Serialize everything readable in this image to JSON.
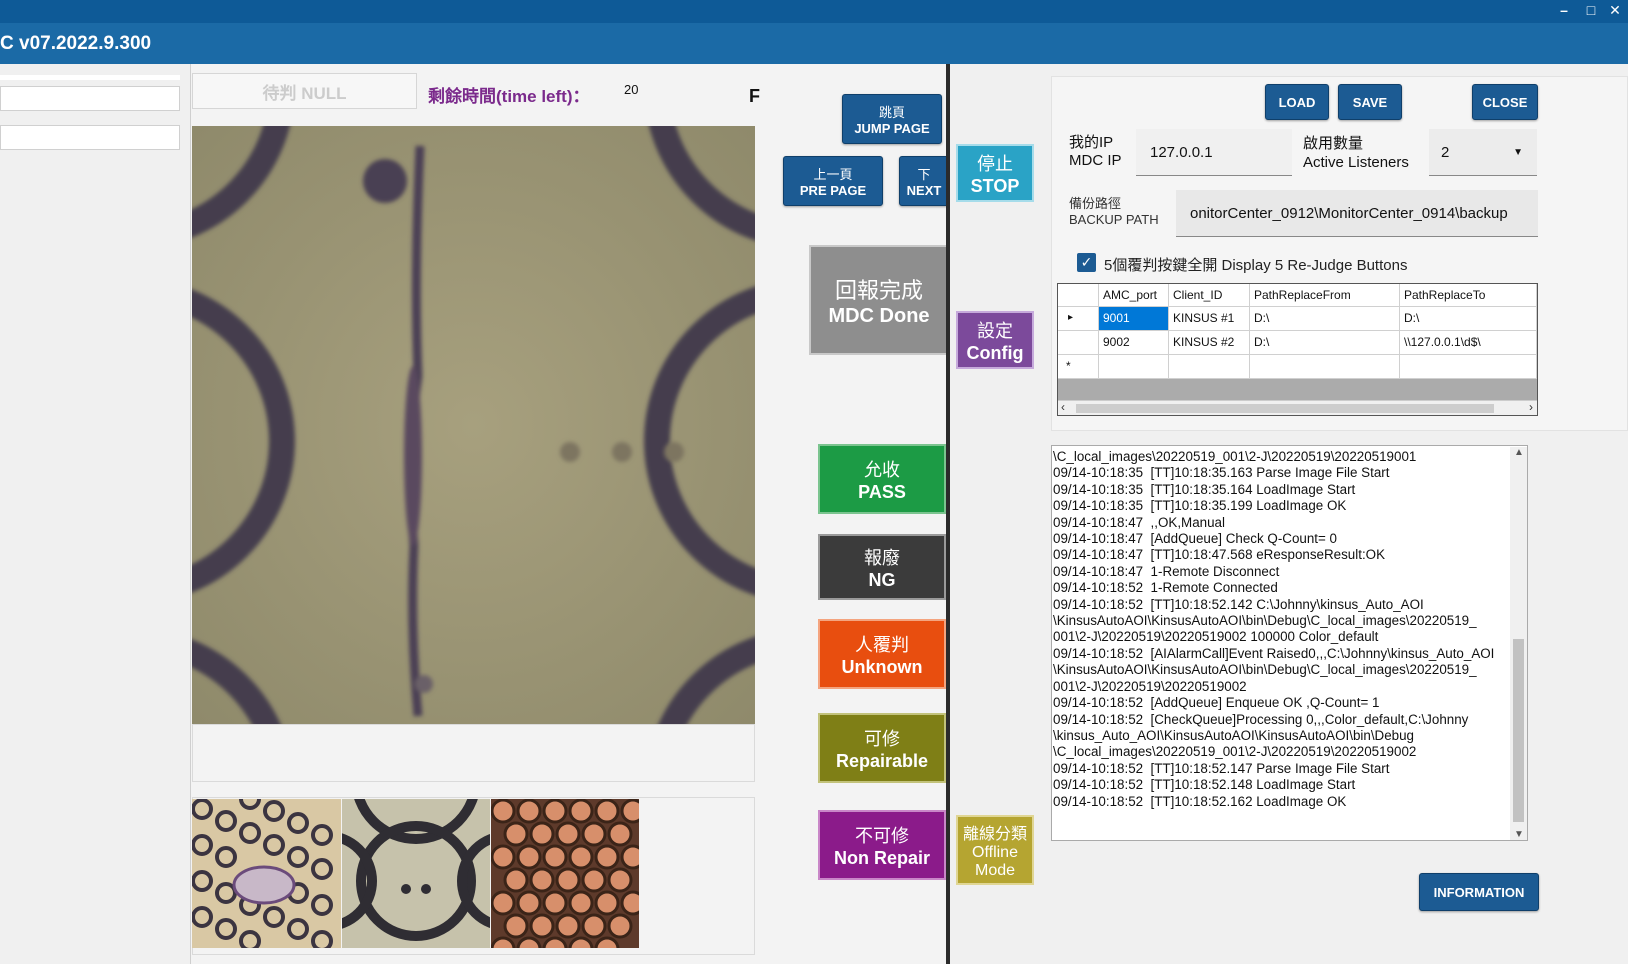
{
  "window": {
    "min": "–",
    "max": "□",
    "close": "✕",
    "title": "C  v07.2022.9.300"
  },
  "judge": {
    "status": "待判 NULL",
    "time_left_label": "剩餘時間(time left)：",
    "time_left_value": "20",
    "right_edge_char": "F"
  },
  "nav": {
    "jump_cn": "跳頁",
    "jump_en": "JUMP PAGE",
    "prev_cn": "上一頁",
    "prev_en": "PRE PAGE",
    "next_cn": "下",
    "next_en": "NEXT"
  },
  "actions": {
    "done_cn": "回報完成",
    "done_en": "MDC Done",
    "pass_cn": "允收",
    "pass_en": "PASS",
    "ng_cn": "報廢",
    "ng_en": "NG",
    "unknown_cn": "人覆判",
    "unknown_en": "Unknown",
    "repairable_cn": "可修",
    "repairable_en": "Repairable",
    "nonrepair_cn": "不可修",
    "nonrepair_en": "Non Repair"
  },
  "side": {
    "stop_cn": "停止",
    "stop_en": "STOP",
    "config_cn": "設定",
    "config_en": "Config",
    "offline_cn": "離線分類",
    "offline_en1": "Offline",
    "offline_en2": "Mode"
  },
  "config": {
    "load": "LOAD",
    "save": "SAVE",
    "close": "CLOSE",
    "ip_label_cn": "我的IP",
    "ip_label_en": "MDC IP",
    "ip_value": "127.0.0.1",
    "listeners_label_cn": "啟用數量",
    "listeners_label_en": "Active Listeners",
    "listeners_value": "2",
    "backup_label_cn": "備份路徑",
    "backup_label_en": "BACKUP PATH",
    "backup_value": "onitorCenter_0912\\MonitorCenter_0914\\backup",
    "checkbox_label": "5個覆判按鍵全開 Display 5 Re-Judge Buttons",
    "information": "INFORMATION"
  },
  "grid": {
    "columns": [
      "AMC_port",
      "Client_ID",
      "PathReplaceFrom",
      "PathReplaceTo"
    ],
    "rows": [
      [
        "9001",
        "KINSUS #1",
        "D:\\",
        "D:\\"
      ],
      [
        "9002",
        "KINSUS #2",
        "D:\\",
        "\\\\127.0.0.1\\d$\\"
      ]
    ],
    "row_marker": "▸",
    "new_row_marker": "*"
  },
  "log": "\\C_local_images\\20220519_001\\2-J\\20220519\\20220519001\n09/14-10:18:35  [TT]10:18:35.163 Parse Image File Start\n09/14-10:18:35  [TT]10:18:35.164 LoadImage Start\n09/14-10:18:35  [TT]10:18:35.199 LoadImage OK\n09/14-10:18:47  ,,OK,Manual\n09/14-10:18:47  [AddQueue] Check Q-Count= 0\n09/14-10:18:47  [TT]10:18:47.568 eResponseResult:OK\n09/14-10:18:47  1-Remote Disconnect\n09/14-10:18:52  1-Remote Connected\n09/14-10:18:52  [TT]10:18:52.142 C:\\Johnny\\kinsus_Auto_AOI\n\\KinsusAutoAOI\\KinsusAutoAOI\\bin\\Debug\\C_local_images\\20220519_\n001\\2-J\\20220519\\20220519002 100000 Color_default\n09/14-10:18:52  [AIAlarmCall]Event Raised0,,,C:\\Johnny\\kinsus_Auto_AOI\n\\KinsusAutoAOI\\KinsusAutoAOI\\bin\\Debug\\C_local_images\\20220519_\n001\\2-J\\20220519\\20220519002\n09/14-10:18:52  [AddQueue] Enqueue OK ,Q-Count= 1\n09/14-10:18:52  [CheckQueue]Processing 0,,,Color_default,C:\\Johnny\n\\kinsus_Auto_AOI\\KinsusAutoAOI\\KinsusAutoAOI\\bin\\Debug\n\\C_local_images\\20220519_001\\2-J\\20220519\\20220519002\n09/14-10:18:52  [TT]10:18:52.147 Parse Image File Start\n09/14-10:18:52  [TT]10:18:52.148 LoadImage Start\n09/14-10:18:52  [TT]10:18:52.162 LoadImage OK",
  "colors": {
    "pass": "#1c9b45",
    "ng": "#3b3b3b",
    "unknown": "#e84e0f",
    "repairable": "#7f7f16",
    "nonrepair": "#8b1b8a",
    "stop": "#2aa3c6",
    "config": "#7c4a9b",
    "offline": "#b5a531",
    "done": "#8e8e8e"
  }
}
